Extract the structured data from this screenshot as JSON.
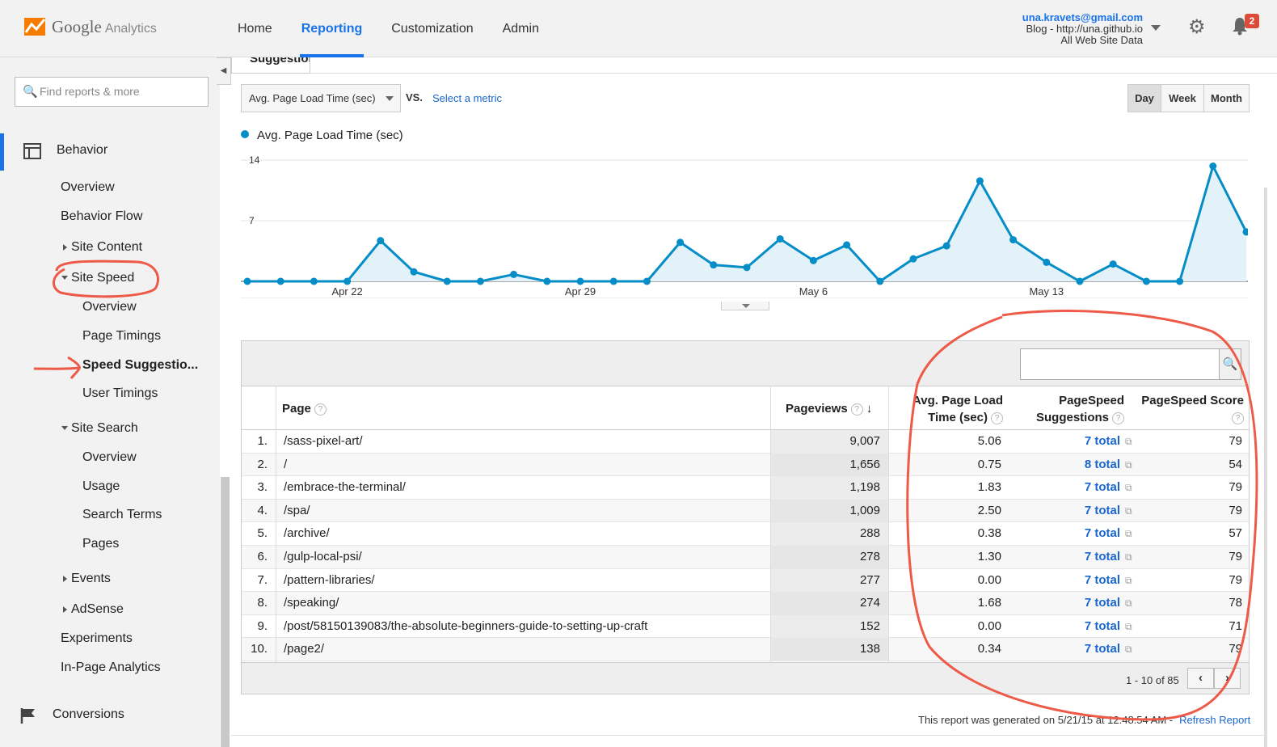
{
  "header": {
    "logo": {
      "brand": "Google",
      "product": "Analytics"
    },
    "nav": [
      "Home",
      "Reporting",
      "Customization",
      "Admin"
    ],
    "active_nav": "Reporting",
    "account": {
      "email": "una.kravets@gmail.com",
      "property": "Blog - http://una.github.io",
      "view": "All Web Site Data"
    },
    "notifications": "2"
  },
  "sidebar": {
    "search_placeholder": "Find reports & more",
    "section_behavior": "Behavior",
    "items": {
      "overview": "Overview",
      "behavior_flow": "Behavior Flow",
      "site_content": "Site Content",
      "site_speed": "Site Speed",
      "ss_overview": "Overview",
      "page_timings": "Page Timings",
      "speed_suggestions": "Speed Suggestio...",
      "user_timings": "User Timings",
      "site_search": "Site Search",
      "sr_overview": "Overview",
      "usage": "Usage",
      "search_terms": "Search Terms",
      "pages": "Pages",
      "events": "Events",
      "adsense": "AdSense",
      "experiments": "Experiments",
      "in_page": "In-Page Analytics"
    },
    "section_conversions": "Conversions"
  },
  "main": {
    "tab": "Suggestions",
    "metric_select": "Avg. Page Load Time (sec)",
    "vs": "VS.",
    "select_metric": "Select a metric",
    "periods": [
      "Day",
      "Week",
      "Month"
    ],
    "active_period": "Day",
    "legend": "Avg. Page Load Time (sec)",
    "search_value": "",
    "columns": {
      "page": "Page",
      "pageviews": "Pageviews",
      "apl_1": "Avg. Page Load",
      "apl_2": "Time (sec)",
      "psg_1": "PageSpeed",
      "psg_2": "Suggestions",
      "score": "PageSpeed Score"
    },
    "rows": [
      {
        "n": "1.",
        "page": "/sass-pixel-art/",
        "pv": "9,007",
        "apl": "5.06",
        "sugg": "7 total",
        "score": "79"
      },
      {
        "n": "2.",
        "page": "/",
        "pv": "1,656",
        "apl": "0.75",
        "sugg": "8 total",
        "score": "54"
      },
      {
        "n": "3.",
        "page": "/embrace-the-terminal/",
        "pv": "1,198",
        "apl": "1.83",
        "sugg": "7 total",
        "score": "79"
      },
      {
        "n": "4.",
        "page": "/spa/",
        "pv": "1,009",
        "apl": "2.50",
        "sugg": "7 total",
        "score": "79"
      },
      {
        "n": "5.",
        "page": "/archive/",
        "pv": "288",
        "apl": "0.38",
        "sugg": "7 total",
        "score": "57"
      },
      {
        "n": "6.",
        "page": "/gulp-local-psi/",
        "pv": "278",
        "apl": "1.30",
        "sugg": "7 total",
        "score": "79"
      },
      {
        "n": "7.",
        "page": "/pattern-libraries/",
        "pv": "277",
        "apl": "0.00",
        "sugg": "7 total",
        "score": "79"
      },
      {
        "n": "8.",
        "page": "/speaking/",
        "pv": "274",
        "apl": "1.68",
        "sugg": "7 total",
        "score": "78"
      },
      {
        "n": "9.",
        "page": "/post/58150139083/the-absolute-beginners-guide-to-setting-up-craft",
        "pv": "152",
        "apl": "0.00",
        "sugg": "7 total",
        "score": "71"
      },
      {
        "n": "10.",
        "page": "/page2/",
        "pv": "138",
        "apl": "0.34",
        "sugg": "7 total",
        "score": "79"
      }
    ],
    "pager": "1 - 10 of 85",
    "report_generated": "This report was generated on 5/21/15 at 12:48:54 AM -",
    "refresh": "Refresh Report"
  },
  "chart_data": {
    "type": "area",
    "title": "",
    "ylabel": "",
    "series": [
      {
        "name": "Avg. Page Load Time (sec)",
        "values": [
          0,
          0,
          0,
          0,
          4.7,
          1.1,
          0,
          0,
          0.8,
          0,
          0,
          0,
          0,
          4.5,
          1.9,
          1.6,
          4.9,
          2.4,
          4.2,
          0,
          2.6,
          4.1,
          11.6,
          4.8,
          2.2,
          0,
          2.0,
          0,
          0,
          13.3,
          5.7
        ]
      }
    ],
    "x_tick_labels": [
      "Apr 22",
      "Apr 29",
      "May 6",
      "May 13"
    ],
    "x_tick_index": [
      3,
      10,
      17,
      24
    ],
    "y_ticks": [
      7,
      14
    ],
    "ylim": [
      0,
      14
    ],
    "grid": true,
    "color": "#058dc7"
  }
}
